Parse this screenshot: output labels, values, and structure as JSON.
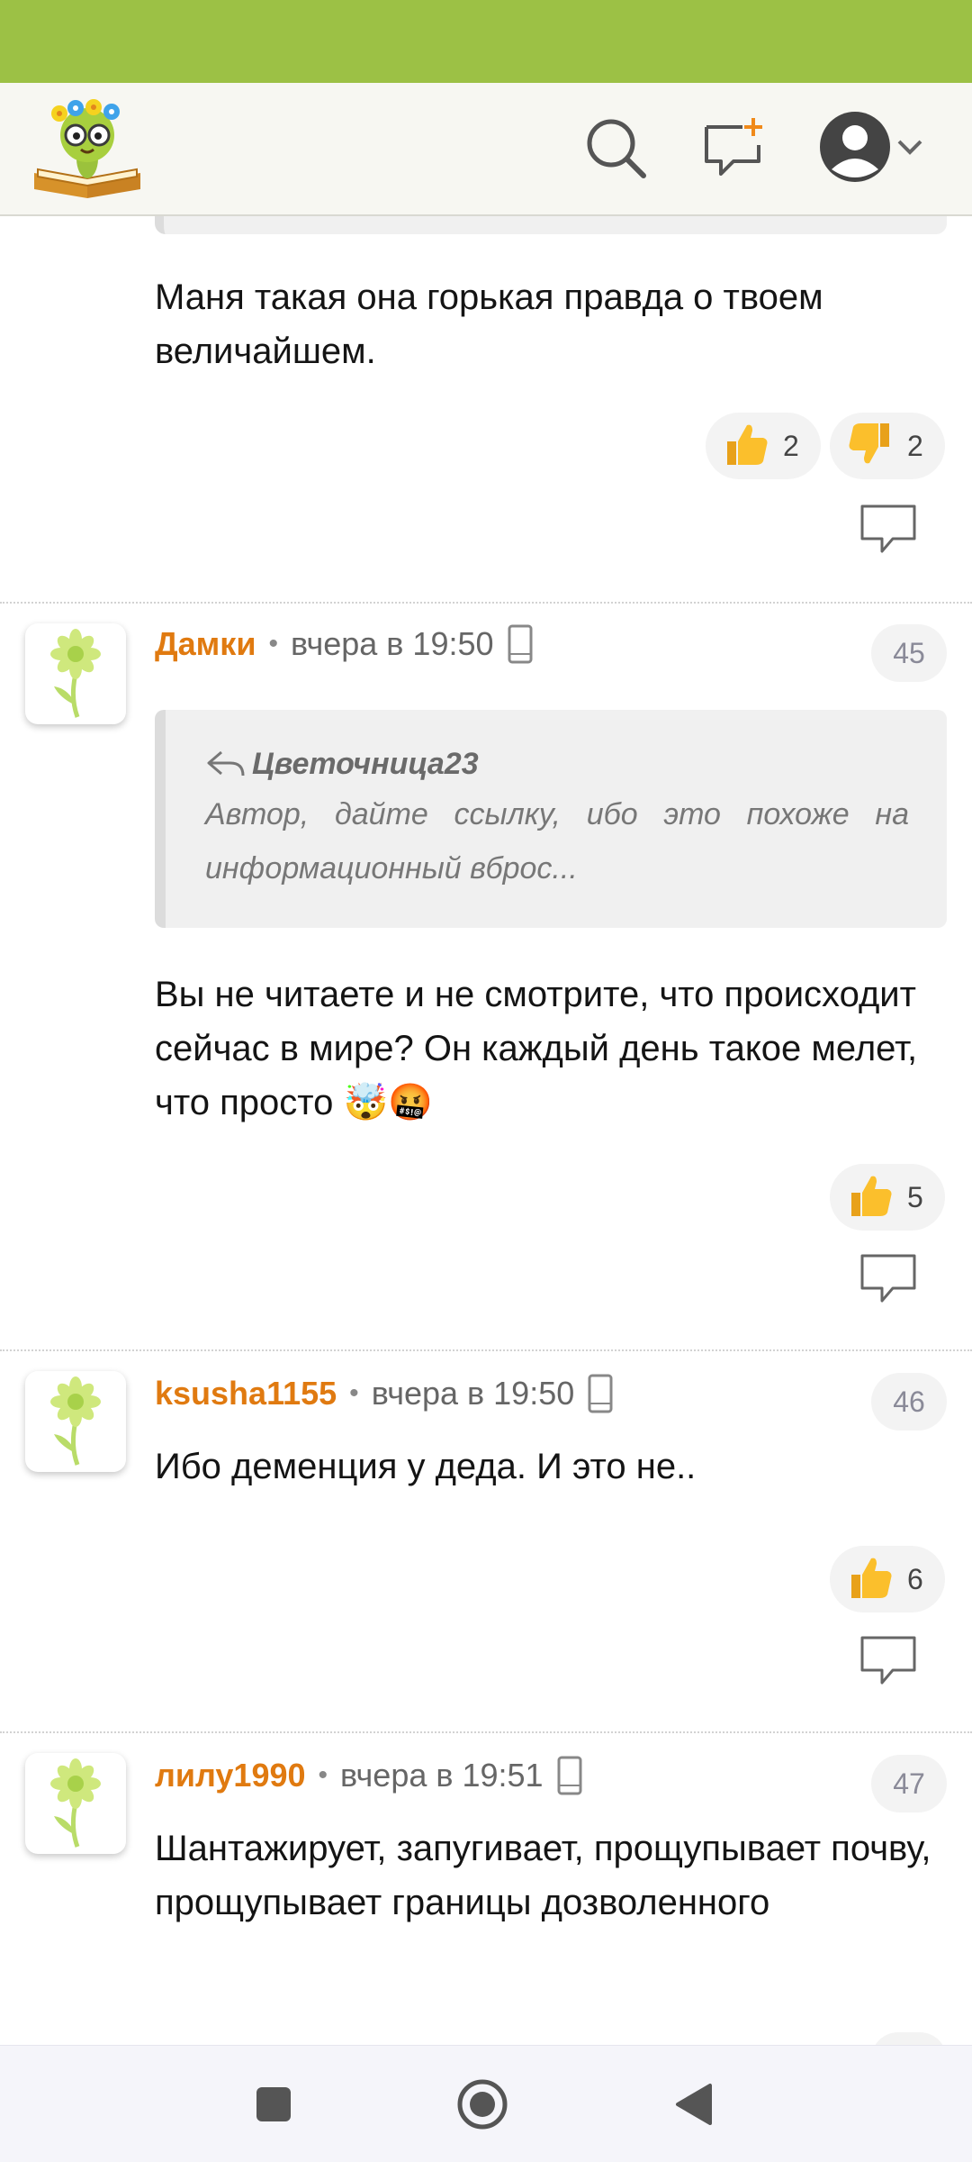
{
  "header": {
    "logo_icon": "bookworm-logo-icon",
    "search_icon": "search-icon",
    "new_comment_icon": "new-comment-icon",
    "profile_icon": "user-avatar-icon",
    "menu_icon": "chevron-down-icon"
  },
  "colors": {
    "status_bar": "#9cc145",
    "author": "#e07a10",
    "badge_text": "#8a8a98"
  },
  "comments": [
    {
      "text": "Маня такая она горькая правда о твоем величайшем.",
      "likes": "2",
      "dislikes": "2"
    },
    {
      "author": "Дамки",
      "time": "вчера в 19:50",
      "number": "45",
      "quote_author": "Цветочница23",
      "quote_text": "Автор, дайте ссылку, ибо это похоже на информационный вброс...",
      "text": "Вы не читаете и не смотрите, что происходит сейчас в мире? Он каждый день такое мелет, что просто 🤯🤬",
      "likes": "5"
    },
    {
      "author": "ksusha1155",
      "time": "вчера в 19:50",
      "number": "46",
      "text": "Ибо деменция у деда. И это не..",
      "likes": "6"
    },
    {
      "author": "лилу1990",
      "time": "вчера в 19:51",
      "number": "47",
      "text": "Шантажирует, запугивает, прощупывает почву, прощупывает границы дозволенного"
    }
  ],
  "meta_separator": "•",
  "nav": {
    "recents_icon": "recents-square-icon",
    "home_icon": "home-circle-icon",
    "back_icon": "back-triangle-icon"
  }
}
